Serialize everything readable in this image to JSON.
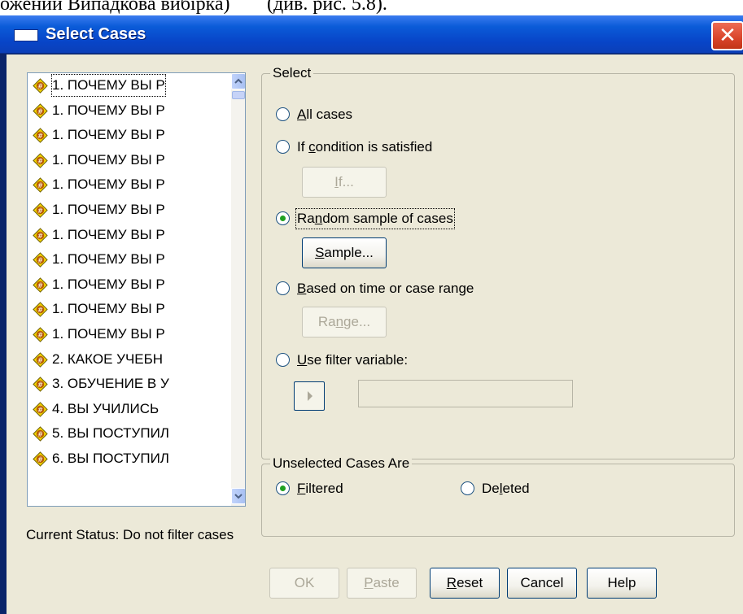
{
  "document_fragment": {
    "lead": "ожении Випадкова вибірка)",
    "tail": "(див. рис. 5.8)."
  },
  "window": {
    "title": "Select Cases",
    "close_glyph": "✕"
  },
  "variables": {
    "items": [
      "1. ПОЧЕМУ ВЫ Р",
      "1. ПОЧЕМУ ВЫ Р",
      "1. ПОЧЕМУ ВЫ Р",
      "1. ПОЧЕМУ ВЫ Р",
      "1. ПОЧЕМУ ВЫ Р",
      "1. ПОЧЕМУ ВЫ Р",
      "1. ПОЧЕМУ ВЫ Р",
      "1. ПОЧЕМУ ВЫ Р",
      "1. ПОЧЕМУ ВЫ Р",
      "1. ПОЧЕМУ ВЫ Р",
      "1. ПОЧЕМУ ВЫ Р",
      "2. КАКОЕ УЧЕБН",
      "3. ОБУЧЕНИЕ В У",
      "4. ВЫ УЧИЛИСЬ",
      "5. ВЫ ПОСТУПИЛ",
      "6. ВЫ ПОСТУПИЛ"
    ],
    "icon": "numeric-variable-icon"
  },
  "select_group": {
    "title": "Select",
    "all_cases": "All cases",
    "if_condition": "If condition is satisfied",
    "if_button": "If...",
    "random_sample": "Random sample of cases",
    "sample_button": "Sample...",
    "time_range": "Based on time or case range",
    "range_button": "Range...",
    "filter_variable": "Use filter variable:",
    "selected_option": "random_sample"
  },
  "unselected_group": {
    "title": "Unselected Cases Are",
    "filtered": "Filtered",
    "deleted": "Deleted",
    "selected_option": "filtered"
  },
  "status": {
    "text": "Current Status: Do not filter cases"
  },
  "buttons": {
    "ok": "OK",
    "paste": "Paste",
    "reset": "Reset",
    "cancel": "Cancel",
    "help": "Help"
  },
  "colors": {
    "title_bar": "#0a5bd8",
    "dialog_bg": "#ece9d8",
    "close_button": "#d9442b",
    "radio_dot": "#21a121",
    "variable_icon": "#f1d400"
  }
}
